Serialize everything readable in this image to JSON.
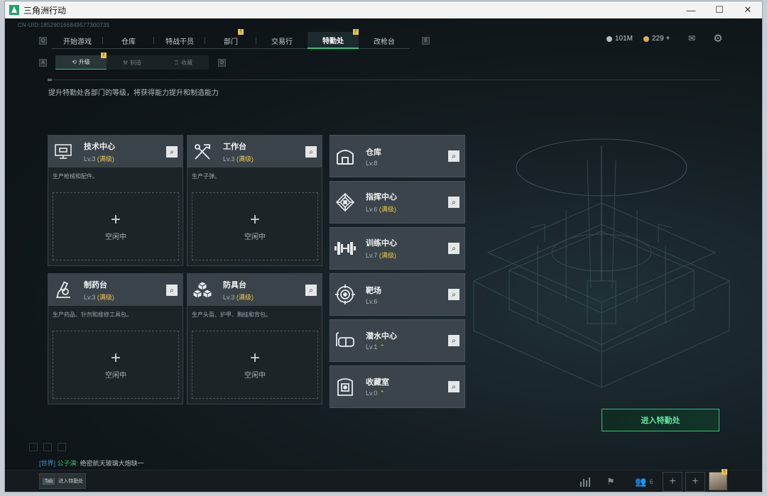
{
  "window": {
    "title": "三角洲行动",
    "controls": [
      "—",
      "☐",
      "✕"
    ]
  },
  "uid": "CN-UID:18529016684957730073​5",
  "topnav": {
    "key_left": "Q",
    "key_right": "E",
    "tabs": [
      {
        "label": "开始游戏"
      },
      {
        "label": "仓库"
      },
      {
        "label": "特战干员"
      },
      {
        "label": "部门",
        "badge": "!"
      },
      {
        "label": "交易行"
      },
      {
        "label": "特勤处",
        "badge": "!",
        "active": true
      },
      {
        "label": "改枪台"
      }
    ]
  },
  "currency": {
    "silver": "101M",
    "gold": "229 +"
  },
  "subnav": {
    "key_left": "A",
    "key_right": "D",
    "tabs": [
      {
        "label": "升级",
        "active": true,
        "badge": "!"
      },
      {
        "label": "制造"
      },
      {
        "label": "收藏"
      }
    ]
  },
  "description": "提升特勤处各部门的等级，将获得能力提升和制造能力",
  "production": {
    "idle_label": "空闲中",
    "plus": "+",
    "cards": [
      {
        "name": "技术中心",
        "level": "Lv.3",
        "maxed": "(满级)",
        "note": "生产枪械和配件。"
      },
      {
        "name": "工作台",
        "level": "Lv.3",
        "maxed": "(满级)",
        "note": "生产子弹。"
      },
      {
        "name": "制药台",
        "level": "Lv.3",
        "maxed": "(满级)",
        "note": "生产药品、针剂和维修工具包。"
      },
      {
        "name": "防具台",
        "level": "Lv.3",
        "maxed": "(满级)",
        "note": "生产头盔、护甲、胸挂和背包。"
      }
    ]
  },
  "facilities": [
    {
      "name": "仓库",
      "level": "Lv.8",
      "maxed": ""
    },
    {
      "name": "指挥中心",
      "level": "Lv.6",
      "maxed": "(满级)"
    },
    {
      "name": "训练中心",
      "level": "Lv.7",
      "maxed": "(满级)"
    },
    {
      "name": "靶场",
      "level": "Lv.6",
      "maxed": ""
    },
    {
      "name": "潜水中心",
      "level": "Lv.1",
      "maxed": "",
      "upgrade": "⌃"
    },
    {
      "name": "收藏室",
      "level": "Lv.0",
      "maxed": "",
      "upgrade": "⌃"
    }
  ],
  "enter_button": "进入特勤处",
  "chat": {
    "channel": "[世界]",
    "nick": "公子演:",
    "message": "绝密航天玻璃大炮缺一"
  },
  "bottom": {
    "tab_key": "Tab",
    "tab_label": "进入特勤处",
    "friends_count": "6",
    "avatar_badge": "!"
  },
  "colors": {
    "accent": "#2fc47a",
    "maxed": "#e9c64d",
    "badge": "#e8c34a"
  }
}
